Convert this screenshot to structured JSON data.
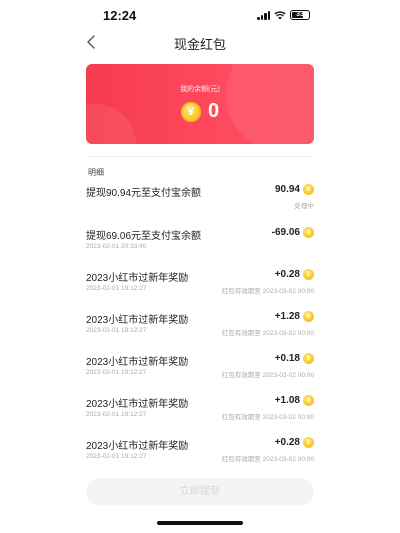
{
  "status_bar": {
    "time": "12:24",
    "battery": "33"
  },
  "header": {
    "title": "现金红包"
  },
  "balance": {
    "label": "我的余额(元)",
    "amount": "0",
    "currency_icon": "yen-coin-icon"
  },
  "details": {
    "section_title": "明细",
    "transactions": [
      {
        "title": "提现90.94元至支付宝余额",
        "amount": "90.94",
        "date": "",
        "note": "处理中"
      },
      {
        "title": "提现69.06元至支付宝余额",
        "amount": "-69.06",
        "date": "2023-02-01 20:33:40",
        "note": ""
      },
      {
        "title": "2023小红市过新年奖励",
        "amount": "+0.28",
        "date": "2023-02-01 19:12:27",
        "note": "红包有效期至 2023-03-02 00:00"
      },
      {
        "title": "2023小红市过新年奖励",
        "amount": "+1.28",
        "date": "2023-02-01 19:12:27",
        "note": "红包有效期至 2023-03-02 00:00"
      },
      {
        "title": "2023小红市过新年奖励",
        "amount": "+0.18",
        "date": "2023-02-01 19:12:27",
        "note": "红包有效期至 2023-03-02 00:00"
      },
      {
        "title": "2023小红市过新年奖励",
        "amount": "+1.08",
        "date": "2023-02-01 19:12:27",
        "note": "红包有效期至 2023-03-02 00:00"
      },
      {
        "title": "2023小红市过新年奖励",
        "amount": "+0.28",
        "date": "2023-02-01 19:12:27",
        "note": "红包有效期至 2023-03-02 00:00"
      }
    ]
  },
  "footer": {
    "withdraw_label": "立即提现"
  },
  "colors": {
    "accent": "#fb3f54",
    "coin": "#f9c82a",
    "disabled_button": "#f4f4f4"
  }
}
